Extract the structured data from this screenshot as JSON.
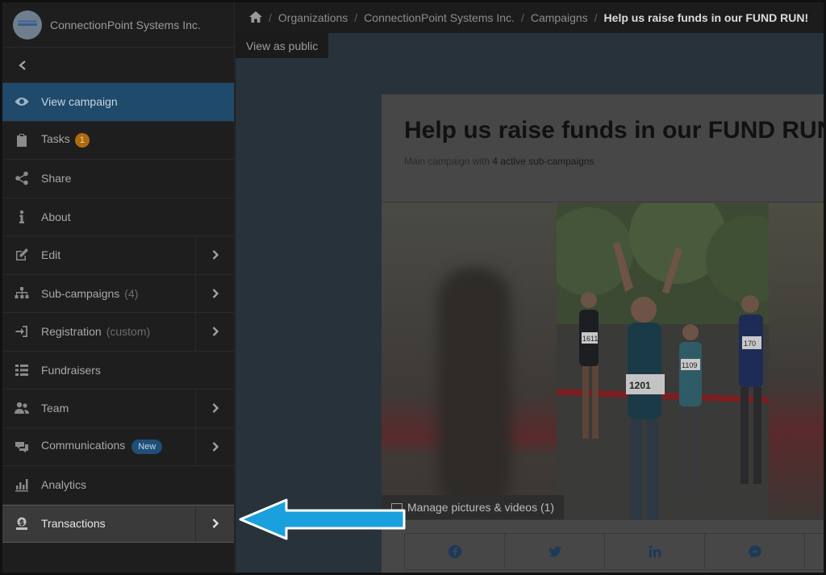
{
  "org": {
    "name": "ConnectionPoint Systems Inc."
  },
  "breadcrumb": {
    "items": [
      "Organizations",
      "ConnectionPoint Systems Inc.",
      "Campaigns"
    ],
    "current": "Help us raise funds in our FUND RUN!"
  },
  "sidebar": {
    "items": [
      {
        "label": "View campaign",
        "icon": "eye-icon",
        "active": true
      },
      {
        "label": "Tasks",
        "icon": "clipboard-icon",
        "badge": "1"
      },
      {
        "label": "Share",
        "icon": "share-icon"
      },
      {
        "label": "About",
        "icon": "info-icon"
      },
      {
        "label": "Edit",
        "icon": "edit-icon",
        "chevron": true
      },
      {
        "label": "Sub-campaigns",
        "sub": "(4)",
        "icon": "sitemap-icon",
        "chevron": true
      },
      {
        "label": "Registration",
        "sub": "(custom)",
        "icon": "sign-in-icon",
        "chevron": true
      },
      {
        "label": "Fundraisers",
        "icon": "list-icon"
      },
      {
        "label": "Team",
        "icon": "users-icon",
        "chevron": true
      },
      {
        "label": "Communications",
        "badge_new": "New",
        "icon": "communications-icon",
        "chevron": true
      },
      {
        "label": "Analytics",
        "icon": "analytics-icon"
      },
      {
        "label": "Transactions",
        "icon": "transactions-icon",
        "chevron": true,
        "highlighted": true
      }
    ]
  },
  "main": {
    "view_public_label": "View as public",
    "campaign": {
      "title": "Help us raise funds in our FUND RUN!",
      "subtitle_prefix": "Main campaign with",
      "subtitle_link": "4 active sub-campaigns"
    },
    "media": {
      "manage_label": "Manage pictures & videos (1)",
      "bib_numbers": [
        "1201",
        "1109",
        "1611",
        "170"
      ]
    },
    "share_buttons": [
      "facebook-icon",
      "twitter-icon",
      "linkedin-icon",
      "messenger-icon"
    ]
  },
  "colors": {
    "accent_blue": "#1f4a6b",
    "arrow_blue": "#1aa0dc",
    "badge_orange": "#b06a10"
  }
}
